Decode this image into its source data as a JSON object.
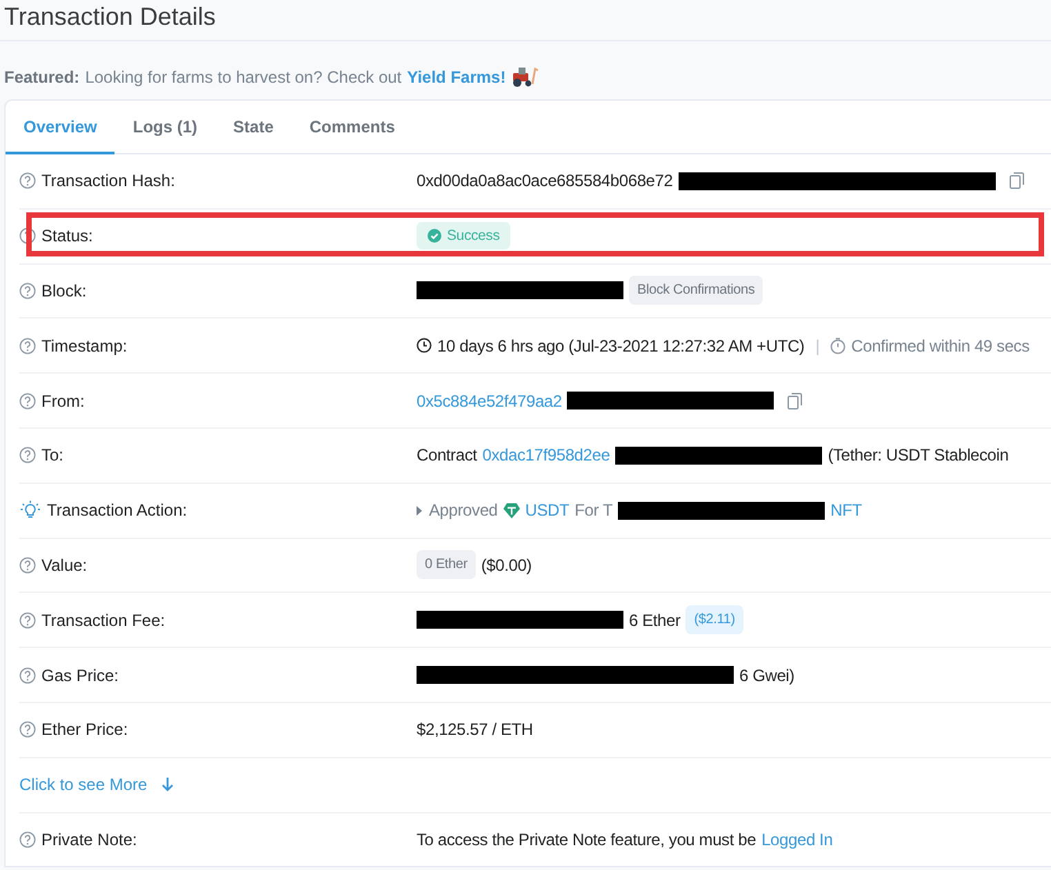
{
  "page_title": "Transaction Details",
  "featured": {
    "label": "Featured:",
    "text": "Looking for farms to harvest on? Check out",
    "link": "Yield Farms!"
  },
  "tabs": [
    {
      "label": "Overview",
      "selected": true
    },
    {
      "label": "Logs (1)",
      "selected": false
    },
    {
      "label": "State",
      "selected": false
    },
    {
      "label": "Comments",
      "selected": false
    }
  ],
  "rows": [
    {
      "kind": "help",
      "label": "Transaction Hash:",
      "highlighted": false,
      "value": [
        {
          "kind": "text",
          "text": "0xd00da0a8ac0ace685584b068e72"
        },
        {
          "kind": "redacted_long"
        },
        {
          "kind": "copy"
        }
      ]
    },
    {
      "kind": "help",
      "label": "Status:",
      "highlighted": true,
      "value": [
        {
          "kind": "status",
          "text": "Success"
        }
      ]
    },
    {
      "kind": "help",
      "label": "Block:",
      "highlighted": false,
      "value": [
        {
          "kind": "redacted"
        },
        {
          "kind": "badge",
          "text": "Block Confirmations"
        }
      ]
    },
    {
      "kind": "help",
      "label": "Timestamp:",
      "highlighted": false,
      "value": [
        {
          "kind": "clock"
        },
        {
          "kind": "text",
          "text": "10 days 6 hrs ago (Jul-23-2021 12:27:32 AM +UTC)"
        },
        {
          "kind": "divider",
          "text": "|"
        },
        {
          "kind": "timer"
        },
        {
          "kind": "muted",
          "text": "Confirmed within 49 secs"
        }
      ]
    },
    {
      "kind": "help",
      "label": "From:",
      "highlighted": false,
      "value": [
        {
          "kind": "link",
          "text": "0x5c884e52f479aa2"
        },
        {
          "kind": "redacted"
        },
        {
          "kind": "copy"
        }
      ]
    },
    {
      "kind": "help",
      "label": "To:",
      "highlighted": false,
      "value": [
        {
          "kind": "text",
          "text": "Contract"
        },
        {
          "kind": "link",
          "text": "0xdac17f958d2ee"
        },
        {
          "kind": "redacted"
        },
        {
          "kind": "text",
          "text": "(Tether: USDT Stablecoin"
        }
      ]
    },
    {
      "kind": "action",
      "label": "Transaction Action:",
      "highlighted": false,
      "value": [
        {
          "kind": "caret"
        },
        {
          "kind": "muted",
          "text": "Approved"
        },
        {
          "kind": "token"
        },
        {
          "kind": "link",
          "text": "USDT"
        },
        {
          "kind": "muted",
          "text": "For T"
        },
        {
          "kind": "redacted"
        },
        {
          "kind": "link",
          "text": "NFT"
        }
      ]
    },
    {
      "kind": "help",
      "label": "Value:",
      "highlighted": false,
      "value": [
        {
          "kind": "badge",
          "text": "0 Ether"
        },
        {
          "kind": "text",
          "text": "($0.00)"
        }
      ]
    },
    {
      "kind": "help",
      "label": "Transaction Fee:",
      "highlighted": false,
      "value": [
        {
          "kind": "redacted"
        },
        {
          "kind": "text",
          "text": "6 Ether"
        },
        {
          "kind": "badge_blue",
          "text": "($2.11)"
        }
      ]
    },
    {
      "kind": "help",
      "label": "Gas Price:",
      "highlighted": false,
      "value": [
        {
          "kind": "redacted_long"
        },
        {
          "kind": "text",
          "text": "6 Gwei)"
        }
      ]
    },
    {
      "kind": "help",
      "label": "Ether Price:",
      "highlighted": false,
      "value": [
        {
          "kind": "text",
          "text": "$2,125.57 / ETH"
        }
      ]
    },
    {
      "kind": "more",
      "label": "Click to see More",
      "highlighted": false,
      "value": []
    },
    {
      "kind": "help",
      "label": "Private Note:",
      "highlighted": false,
      "value": [
        {
          "kind": "text",
          "text": "To access the Private Note feature, you must be"
        },
        {
          "kind": "link",
          "text": "Logged In"
        }
      ]
    }
  ]
}
